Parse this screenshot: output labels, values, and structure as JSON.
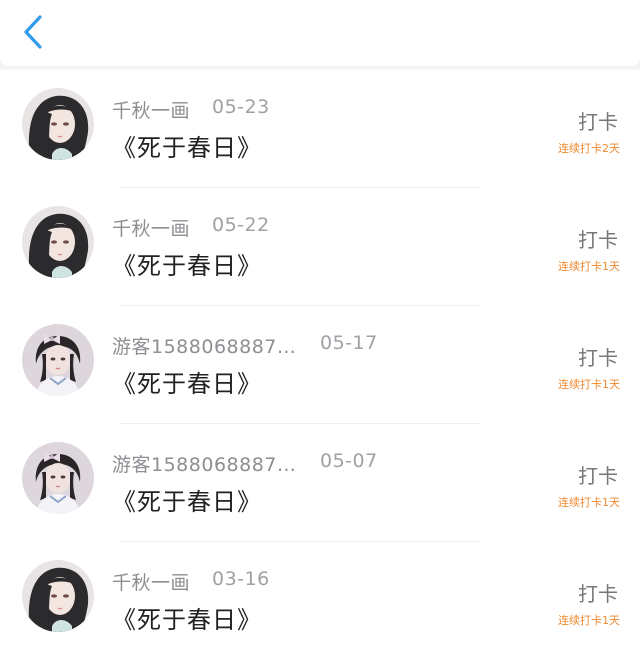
{
  "header": {
    "back_icon": "chevron-left-icon",
    "accent_color": "#2f9bea"
  },
  "colors": {
    "streak": "#f0892f",
    "title": "#222222",
    "meta": "#8e8e93"
  },
  "entries": [
    {
      "user": "千秋一画",
      "date": "05-23",
      "title": "《死于春日》",
      "action": "打卡",
      "streak": "连续打卡2天",
      "avatar": "avatar-long-hair-girl"
    },
    {
      "user": "千秋一画",
      "date": "05-22",
      "title": "《死于春日》",
      "action": "打卡",
      "streak": "连续打卡1天",
      "avatar": "avatar-long-hair-girl"
    },
    {
      "user": "游客1588068887…",
      "date": "05-17",
      "title": "《死于春日》",
      "action": "打卡",
      "streak": "连续打卡1天",
      "avatar": "avatar-bow-girl"
    },
    {
      "user": "游客1588068887…",
      "date": "05-07",
      "title": "《死于春日》",
      "action": "打卡",
      "streak": "连续打卡1天",
      "avatar": "avatar-bow-girl"
    },
    {
      "user": "千秋一画",
      "date": "03-16",
      "title": "《死于春日》",
      "action": "打卡",
      "streak": "连续打卡1天",
      "avatar": "avatar-long-hair-girl"
    }
  ]
}
